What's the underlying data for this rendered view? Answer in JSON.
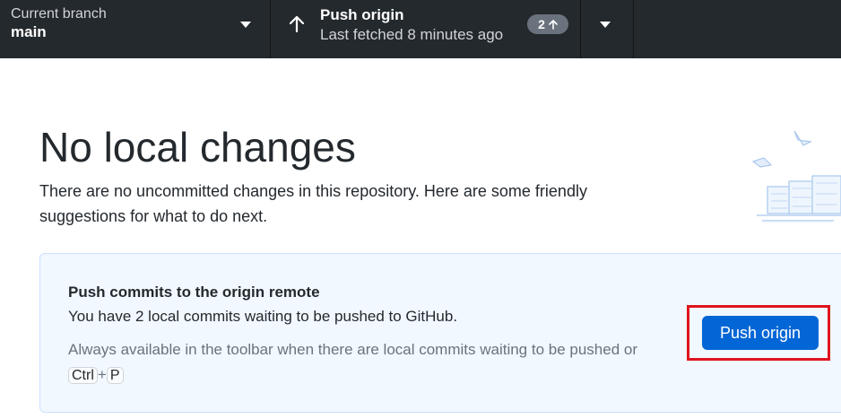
{
  "toolbar": {
    "branch": {
      "label": "Current branch",
      "value": "main"
    },
    "push": {
      "title": "Push origin",
      "subtitle": "Last fetched 8 minutes ago",
      "badge_count": "2"
    }
  },
  "main": {
    "title": "No local changes",
    "subtitle": "There are no uncommitted changes in this repository. Here are some friendly suggestions for what to do next."
  },
  "card": {
    "title": "Push commits to the origin remote",
    "description": "You have 2 local commits waiting to be pushed to GitHub.",
    "hint_prefix": "Always available in the toolbar when there are local commits waiting to be pushed or",
    "shortcut_key1": "Ctrl",
    "shortcut_plus": "+",
    "shortcut_key2": "P",
    "button_label": "Push origin"
  },
  "colors": {
    "toolbar_bg": "#24292e",
    "accent_blue": "#0366d6",
    "card_bg": "#f1f8ff",
    "highlight_red": "#e0141d"
  }
}
